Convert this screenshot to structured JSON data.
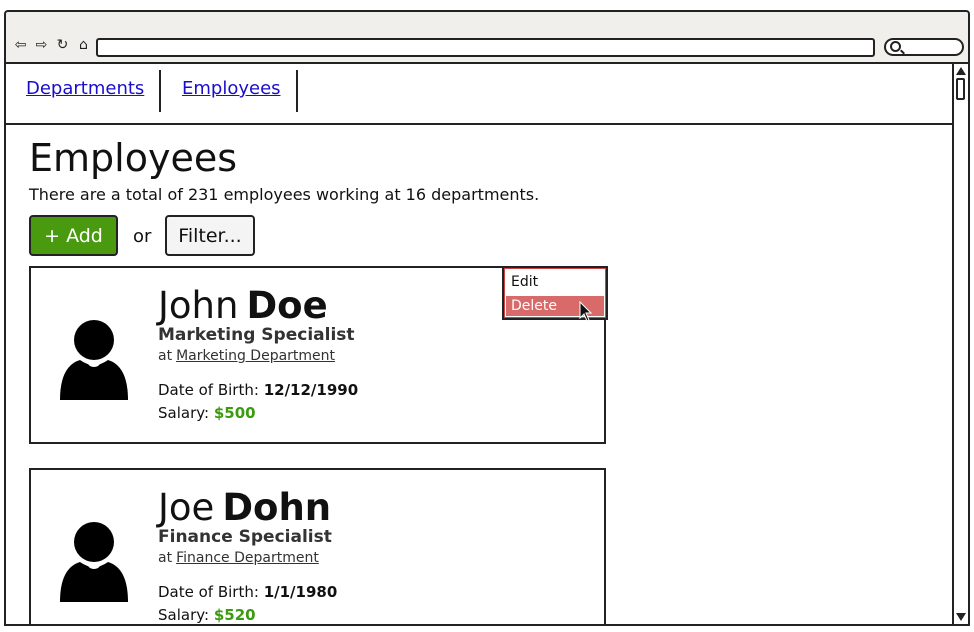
{
  "browser": {
    "nav_icons": [
      "back-icon",
      "forward-icon",
      "reload-icon",
      "home-icon"
    ],
    "search_icon": "search-icon"
  },
  "tabs": [
    {
      "label": "Departments"
    },
    {
      "label": "Employees"
    }
  ],
  "page": {
    "title": "Employees",
    "summary": "There are a total of 231 employees working at 16 departments.",
    "add_label": "+ Add",
    "or_label": "or",
    "filter_label": "Filter..."
  },
  "employees": [
    {
      "first_name": "John",
      "last_name": "Doe",
      "role": "Marketing Specialist",
      "at_label": "at",
      "department": "Marketing Department",
      "dob_label": "Date of Birth:",
      "dob": "12/12/1990",
      "salary_label": "Salary:",
      "salary": "$500"
    },
    {
      "first_name": "Joe",
      "last_name": "Dohn",
      "role": "Finance Specialist",
      "at_label": "at",
      "department": "Finance Department",
      "dob_label": "Date of Birth:",
      "dob": "1/1/1980",
      "salary_label": "Salary:",
      "salary": "$520"
    }
  ],
  "context_menu": {
    "edit_label": "Edit",
    "delete_label": "Delete"
  },
  "colors": {
    "add_button": "#4a9a10",
    "salary": "#3a9a10",
    "delete_highlight": "#d96a6a",
    "link": "#1a0dcc"
  }
}
